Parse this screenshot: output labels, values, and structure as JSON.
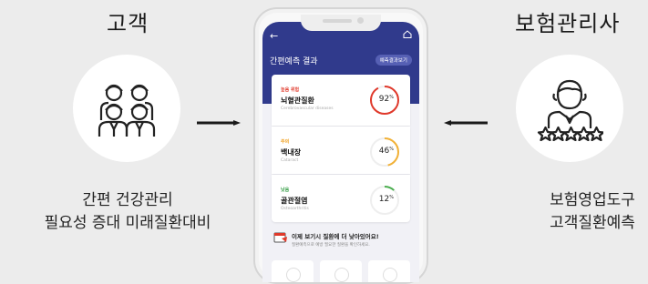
{
  "left": {
    "title": "고객",
    "caption_line1": "간편 건강관리",
    "caption_line2": "필요성 증대 미래질환대비"
  },
  "right": {
    "title": "보험관리사",
    "caption_line1": "보험영업도구",
    "caption_line2": "고객질환예측"
  },
  "phone": {
    "back": "←",
    "header_title": "간편예측 결과",
    "header_link": "예측결과보기",
    "results": [
      {
        "risk": "높음 위험",
        "risk_color": "#e0392b",
        "name": "뇌혈관질환",
        "sub": "Cerebrovascular diseases",
        "value": 92,
        "unit": "%",
        "gauge_color": "#e0392b"
      },
      {
        "risk": "주의",
        "risk_color": "#f0a020",
        "name": "백내장",
        "sub": "Cataract",
        "value": 46,
        "unit": "%",
        "gauge_color": "#f2b136"
      },
      {
        "risk": "낮음",
        "risk_color": "#3aa04a",
        "name": "골관절염",
        "sub": "Osteoarthritis",
        "value": 12,
        "unit": "%",
        "gauge_color": "#4caf50"
      }
    ],
    "promo_title": "이제 보기시 질환에 더 낮아있어요!",
    "promo_sub": "질환예측으로 예방 필요한 질환을 확인하세요."
  }
}
